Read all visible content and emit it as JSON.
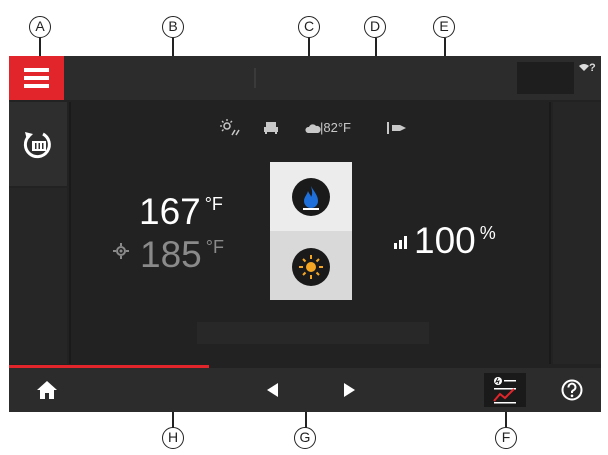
{
  "callouts": {
    "a": "A",
    "b": "B",
    "c": "C",
    "d": "D",
    "e": "E",
    "f": "F",
    "g": "G",
    "h": "H"
  },
  "colors": {
    "accent_red": "#e2252b",
    "flame_blue": "#1e6fd9",
    "sun_orange": "#f5a623",
    "screen_bg": "#222222"
  },
  "topbar": {
    "menu_icon": "hamburger-menu-icon",
    "wifi_icon": "wifi-unknown-icon",
    "wifi_mark": "?"
  },
  "sidebar": {
    "heating_circuit_icon": "heating-circuit-icon"
  },
  "status": {
    "outside_temp": "|82°F"
  },
  "temperatures": {
    "actual_value": "167",
    "actual_unit": "°F",
    "setpoint_value": "185",
    "setpoint_unit": "°F"
  },
  "modes": {
    "flame_icon": "flame-icon",
    "sun_icon": "sun-icon"
  },
  "modulation": {
    "value": "100",
    "unit": "%"
  },
  "bottombar": {
    "home_icon": "home-icon",
    "prev_icon": "left-arrow-icon",
    "next_icon": "right-arrow-icon",
    "energy_icon": "energy-cockpit-icon",
    "help_icon": "question-mark-icon"
  }
}
